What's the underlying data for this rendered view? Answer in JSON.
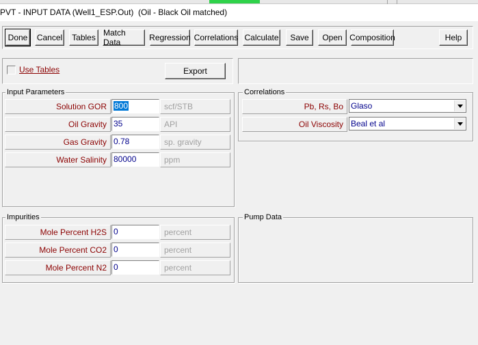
{
  "window": {
    "title": "PVT - INPUT DATA (Well1_ESP.Out)  (Oil - Black Oil matched)"
  },
  "toolbar": {
    "done": "Done",
    "cancel": "Cancel",
    "tables": "Tables",
    "match_data": "Match Data",
    "regression": "Regression",
    "correlations": "Correlations",
    "calculate": "Calculate",
    "save": "Save",
    "open": "Open",
    "composition": "Composition",
    "help": "Help"
  },
  "options": {
    "use_tables_label": "Use Tables",
    "use_tables_checked": false,
    "export_label": "Export"
  },
  "input_parameters": {
    "title": "Input Parameters",
    "rows": [
      {
        "label": "Solution GOR",
        "value": "800",
        "unit": "scf/STB"
      },
      {
        "label": "Oil Gravity",
        "value": "35",
        "unit": "API"
      },
      {
        "label": "Gas Gravity",
        "value": "0.78",
        "unit": "sp. gravity"
      },
      {
        "label": "Water Salinity",
        "value": "80000",
        "unit": "ppm"
      }
    ]
  },
  "correlations": {
    "title": "Correlations",
    "rows": [
      {
        "label": "Pb, Rs, Bo",
        "value": "Glaso"
      },
      {
        "label": "Oil Viscosity",
        "value": "Beal et al"
      }
    ]
  },
  "impurities": {
    "title": "Impurities",
    "rows": [
      {
        "label": "Mole Percent H2S",
        "value": "0",
        "unit": "percent"
      },
      {
        "label": "Mole Percent CO2",
        "value": "0",
        "unit": "percent"
      },
      {
        "label": "Mole Percent N2",
        "value": "0",
        "unit": "percent"
      }
    ]
  },
  "pump_data": {
    "title": "Pump Data"
  },
  "colors": {
    "label_text": "#8b0000",
    "value_text": "#00008b",
    "unit_text": "#a0a0a0",
    "selection": "#0078d7"
  }
}
